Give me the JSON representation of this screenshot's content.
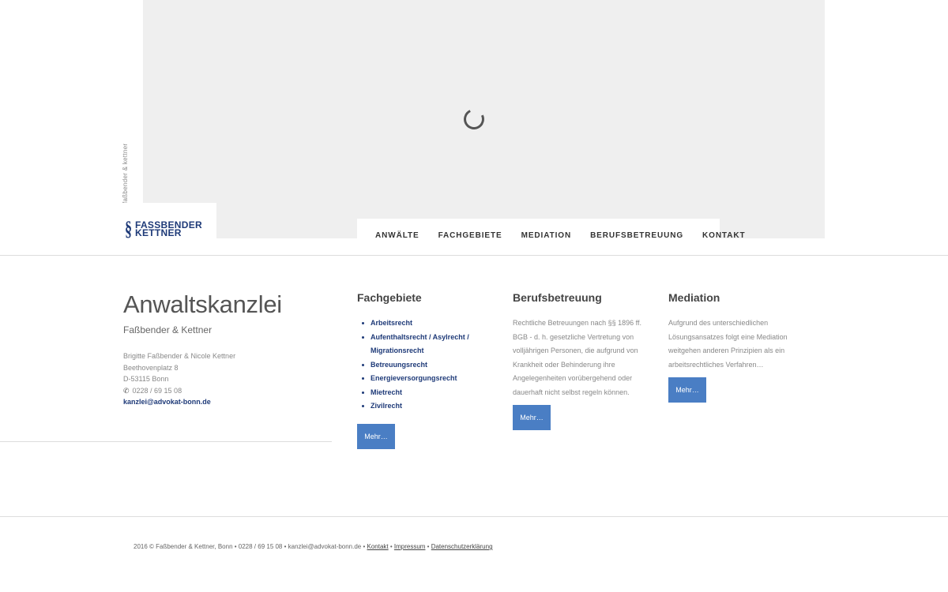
{
  "header": {
    "vertical_text": "faßbender & kettner",
    "logo": {
      "line1": "FASSBENDER",
      "line2": "KETTNER"
    },
    "nav": [
      "ANWÄLTE",
      "FACHGEBIETE",
      "MEDIATION",
      "BERUFSBETREUUNG",
      "KONTAKT"
    ]
  },
  "firm": {
    "title": "Anwaltskanzlei",
    "subtitle": "Faßbender & Kettner",
    "names": "Brigitte Faßbender & Nicole Kettner",
    "street": "Beethovenplatz 8",
    "city": "D-53115 Bonn",
    "phone": "0228 / 69 15 08",
    "email": "kanzlei@advokat-bonn.de"
  },
  "fachgebiete": {
    "title": "Fachgebiete",
    "items": [
      "Arbeitsrecht",
      "Aufenthaltsrecht / Asylrecht / Migrationsrecht",
      "Betreuungsrecht",
      "Energieversorgungsrecht",
      "Mietrecht",
      "Zivilrecht"
    ],
    "button": "Mehr…"
  },
  "berufsbetreuung": {
    "title": "Berufsbetreuung",
    "text": "Rechtliche Betreuungen nach §§ 1896 ff. BGB - d. h. gesetzliche Vertretung von volljährigen Personen, die aufgrund von Krankheit oder Behinderung ihre Angelegenheiten vorübergehend oder dauerhaft nicht selbst regeln können.",
    "button": "Mehr…"
  },
  "mediation": {
    "title": "Mediation",
    "text": "Aufgrund des unterschiedlichen Lösungsansatzes folgt eine Mediation weitgehen anderen Prinzipien als ein arbeitsrechtliches Verfahren…",
    "button": "Mehr…"
  },
  "footer": {
    "text": "2016 © Faßbender & Kettner, Bonn • 0228 / 69 15 08 • kanzlei@advokat-bonn.de • ",
    "links": [
      "Kontakt",
      "Impressum",
      "Datenschutzerklärung"
    ],
    "separator": " • "
  },
  "colors": {
    "brand": "#1e3a78",
    "button": "#4a7ec4",
    "hero_bg": "#efefef"
  },
  "icons": [
    "loading-spinner-icon",
    "phone-icon"
  ]
}
